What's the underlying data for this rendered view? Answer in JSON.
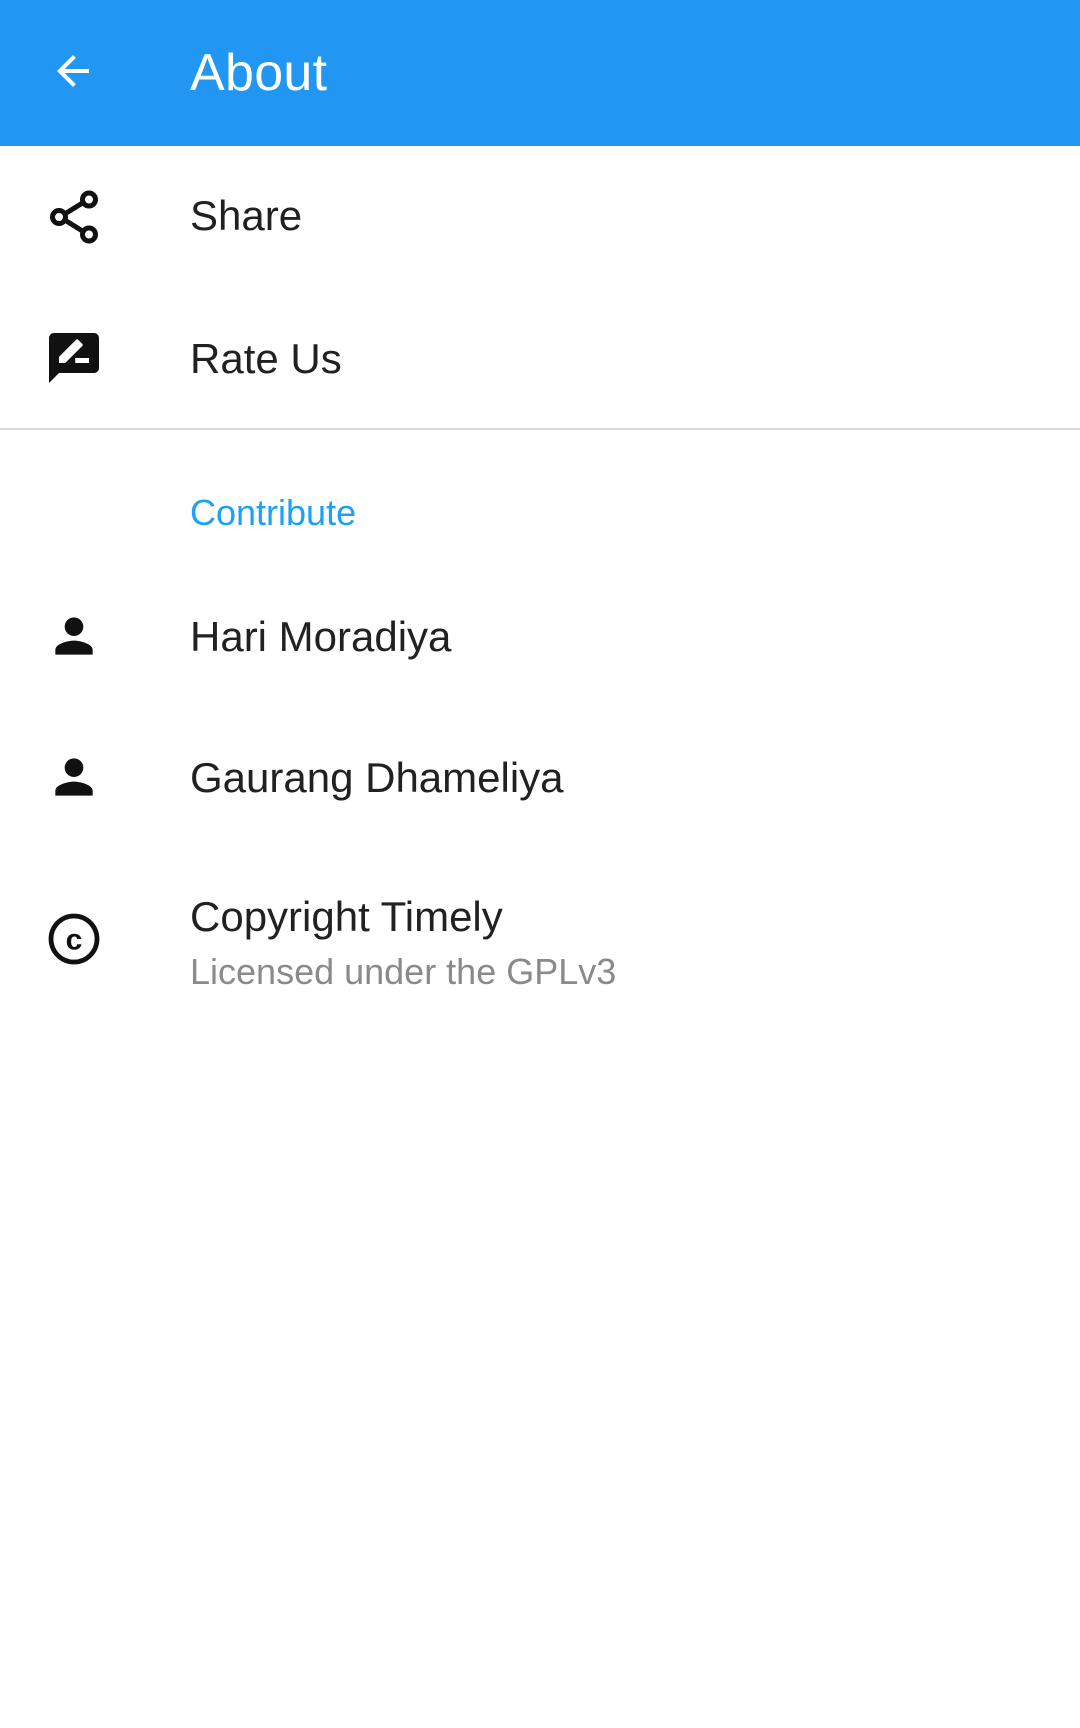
{
  "app_bar": {
    "title": "About",
    "back_icon": "arrow-back-icon",
    "color": "#2196F3"
  },
  "items": [
    {
      "label": "Share",
      "icon": "share-icon"
    },
    {
      "label": "Rate Us",
      "icon": "rate-review-icon"
    }
  ],
  "contribute": {
    "header": "Contribute",
    "header_color": "#1DA1F2",
    "people": [
      {
        "name": "Hari Moradiya",
        "icon": "person-icon"
      },
      {
        "name": "Gaurang Dhameliya",
        "icon": "person-icon"
      }
    ]
  },
  "copyright": {
    "title": "Copyright Timely",
    "subtitle": "Licensed under the GPLv3",
    "icon": "copyright-icon"
  }
}
